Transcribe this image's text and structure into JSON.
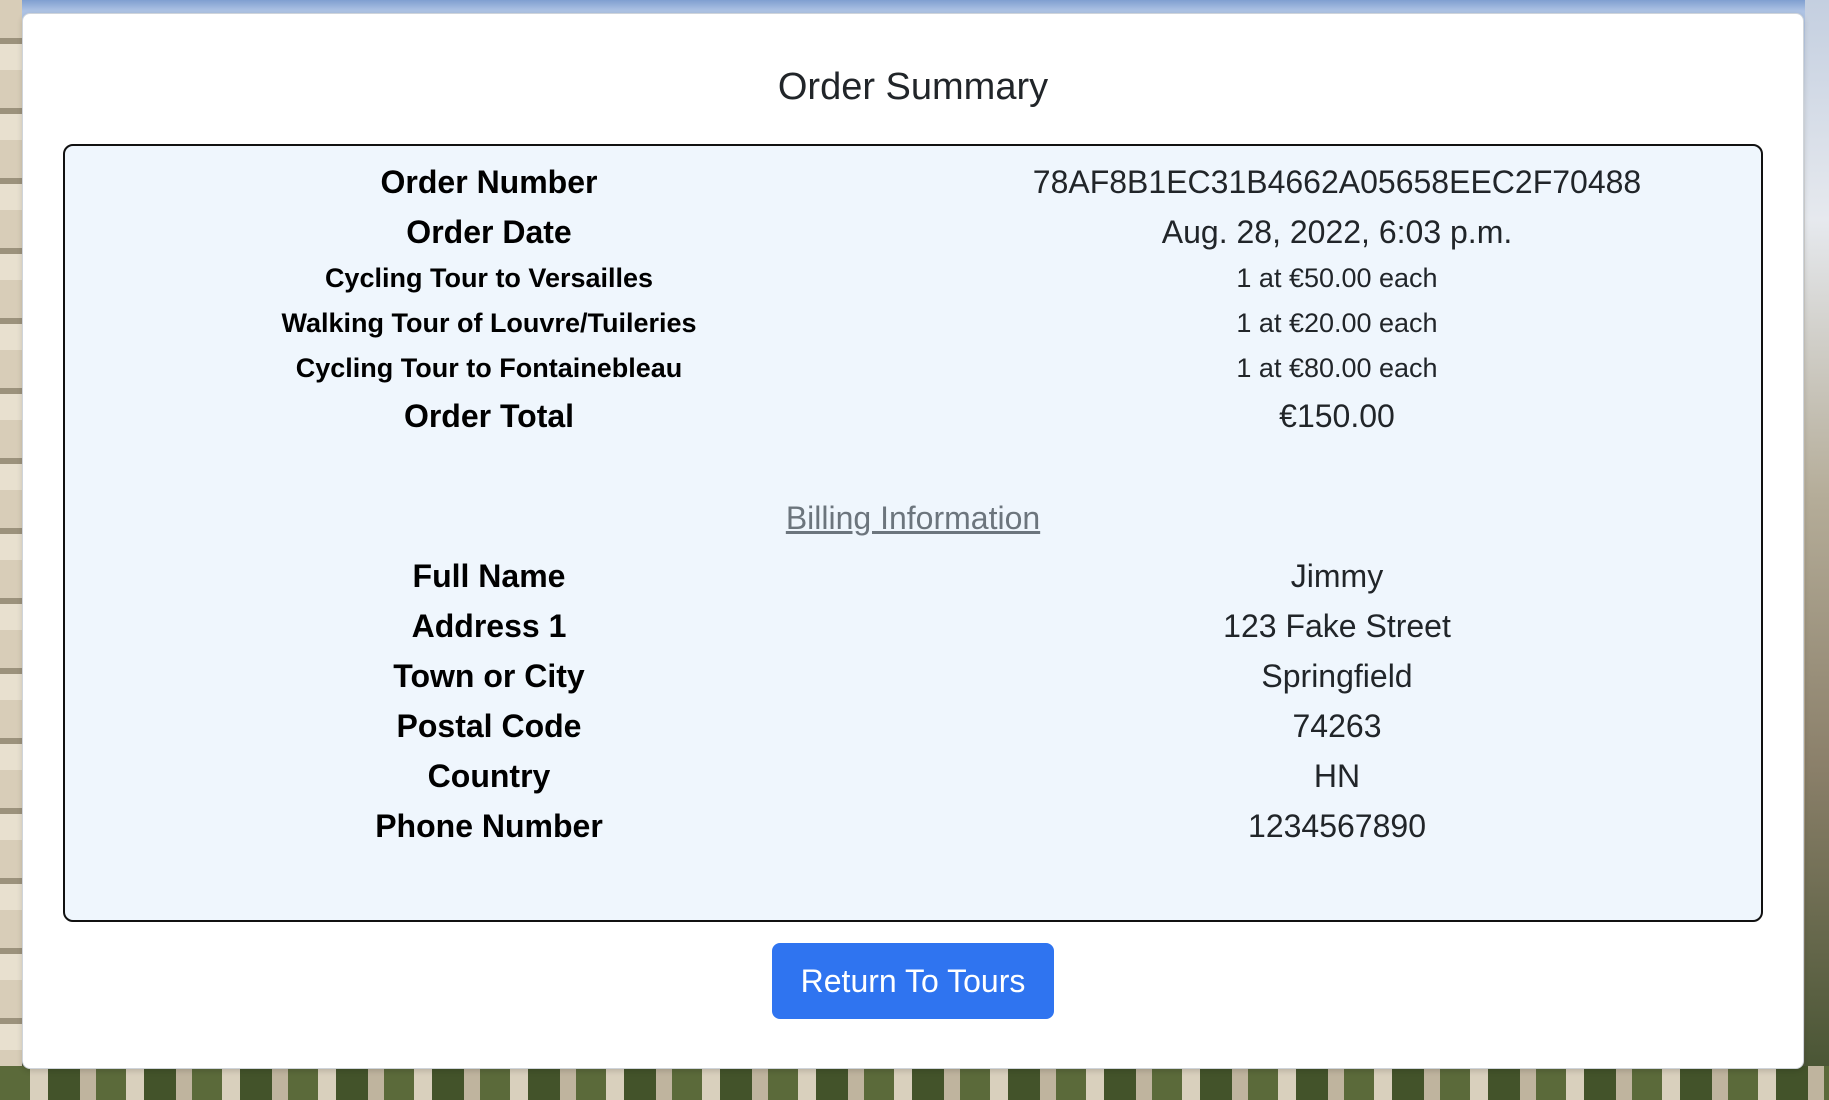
{
  "page": {
    "title": "Order Summary"
  },
  "order": {
    "rows": [
      {
        "label": "Order Number",
        "value": "78AF8B1EC31B4662A05658EEC2F70488"
      },
      {
        "label": "Order Date",
        "value": "Aug. 28, 2022, 6:03 p.m."
      },
      {
        "label": "Cycling Tour to Versailles",
        "value": "1 at €50.00 each"
      },
      {
        "label": "Walking Tour of Louvre/Tuileries",
        "value": "1 at €20.00 each"
      },
      {
        "label": "Cycling Tour to Fontainebleau",
        "value": "1 at €80.00 each"
      },
      {
        "label": "Order Total",
        "value": "€150.00"
      }
    ]
  },
  "billing": {
    "heading": "Billing Information",
    "rows": [
      {
        "label": "Full Name",
        "value": "Jimmy"
      },
      {
        "label": "Address 1",
        "value": "123 Fake Street"
      },
      {
        "label": "Town or City",
        "value": "Springfield"
      },
      {
        "label": "Postal Code",
        "value": "74263"
      },
      {
        "label": "Country",
        "value": "HN"
      },
      {
        "label": "Phone Number",
        "value": "1234567890"
      }
    ]
  },
  "actions": {
    "return_label": "Return To Tours"
  },
  "colors": {
    "summary_bg": "#eff6fd",
    "button_bg": "#2f74f0",
    "link_gray": "#6c757d"
  }
}
